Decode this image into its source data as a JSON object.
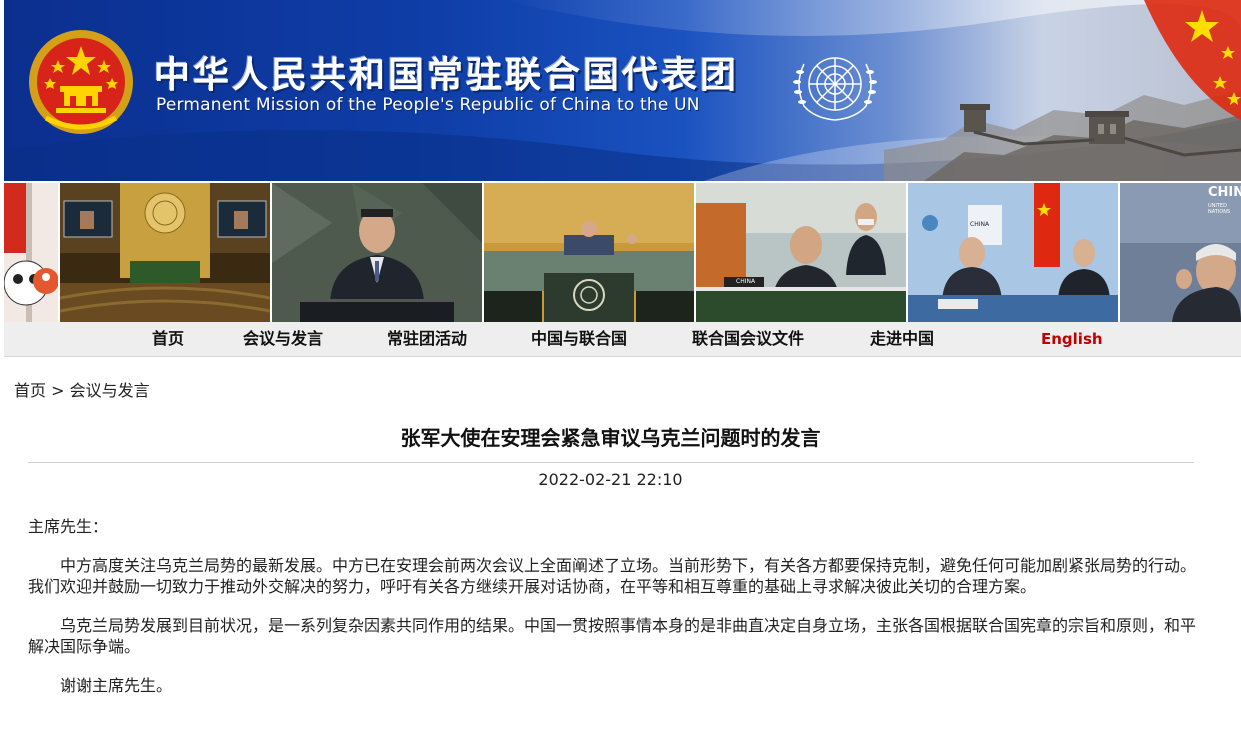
{
  "banner": {
    "title_cn": "中华人民共和国常驻联合国代表团",
    "title_en": "Permanent Mission of the People's Republic of China to the UN"
  },
  "photos": {
    "labels": [
      "CHINA",
      "CHINA",
      "CHIN",
      "UNITED NATIONS"
    ]
  },
  "nav": {
    "items": [
      "首页",
      "会议与发言",
      "常驻团活动",
      "中国与联合国",
      "联合国会议文件",
      "走进中国"
    ],
    "english": "English"
  },
  "breadcrumb": {
    "home": "首页",
    "separator": ">",
    "section": "会议与发言"
  },
  "article": {
    "title": "张军大使在安理会紧急审议乌克兰问题时的发言",
    "date": "2022-02-21 22:10",
    "salutation": "主席先生：",
    "paragraphs": [
      "中方高度关注乌克兰局势的最新发展。中方已在安理会前两次会议上全面阐述了立场。当前形势下，有关各方都要保持克制，避免任何可能加剧紧张局势的行动。我们欢迎并鼓励一切致力于推动外交解决的努力，呼吁有关各方继续开展对话协商，在平等和相互尊重的基础上寻求解决彼此关切的合理方案。",
      "乌克兰局势发展到目前状况，是一系列复杂因素共同作用的结果。中国一贯按照事情本身的是非曲直决定自身立场，主张各国根据联合国宪章的宗旨和原则，和平解决国际争端。",
      "谢谢主席先生。"
    ]
  },
  "colors": {
    "banner_blue": "#0f3ea8",
    "nav_background": "#eeeeee",
    "english_link": "#c00000",
    "flag_red": "#de2910",
    "flag_yellow": "#ffde00"
  }
}
